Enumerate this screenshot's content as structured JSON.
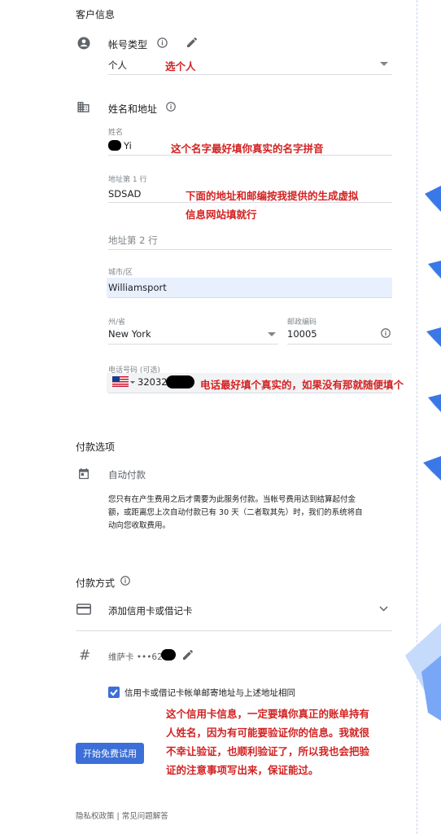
{
  "customer_info": {
    "title": "客户信息",
    "account_type": {
      "label": "帐号类型",
      "value": "个人",
      "note": "选个人"
    },
    "name_address": {
      "label": "姓名和地址"
    },
    "name": {
      "label": "姓名",
      "value": "Yi",
      "note": "这个名字最好填你真实的名字拼音"
    },
    "address1": {
      "label": "地址第 1 行",
      "value": "SDSAD",
      "note_line1": "下面的地址和邮编按我提供的生成虚拟",
      "note_line2": "信息网站填就行"
    },
    "address2": {
      "placeholder": "地址第 2 行"
    },
    "city": {
      "label": "城市/区",
      "value": "Williamsport"
    },
    "state": {
      "label": "州/省",
      "value": "New York"
    },
    "zip": {
      "label": "邮政编码",
      "value": "10005"
    },
    "phone": {
      "label": "电话号码 (可选)",
      "value": "32032",
      "note": "电话最好填个真实的，如果没有那就随便填个"
    }
  },
  "payment_options": {
    "title": "付款选项",
    "auto_pay": {
      "label": "自动付款",
      "description_line1": "您只有在产生费用之后才需要为此服务付款。当帐号费用达到结算起付金",
      "description_line2": "额，或距离您上次自动付款已有 30 天（二者取其先）时，我们的系统将自",
      "description_line3": "动向您收取费用。"
    }
  },
  "payment_method": {
    "title": "付款方式",
    "add_card": "添加信用卡或借记卡",
    "card_number": {
      "label": "维萨卡 •••62"
    },
    "same_address": {
      "label": "信用卡或借记卡帐单邮寄地址与上述地址相同",
      "checked": true
    },
    "note_line1": "这个信用卡信息，一定要填你真正的账单持有",
    "note_line2": "人姓名，因为有可能要验证你的信息。我就很",
    "note_line3": "不幸让验证，也顺利验证了，所以我也会把验",
    "note_line4": "证的注意事项写出来，保证能过。"
  },
  "start_trial_button": "开始免费试用",
  "footer": {
    "links": "隐私权政策 | 常见问题解答"
  },
  "colors": {
    "accent": "#3c6fd7",
    "annotation": "#d32222",
    "highlight": "#e8f0fe"
  }
}
